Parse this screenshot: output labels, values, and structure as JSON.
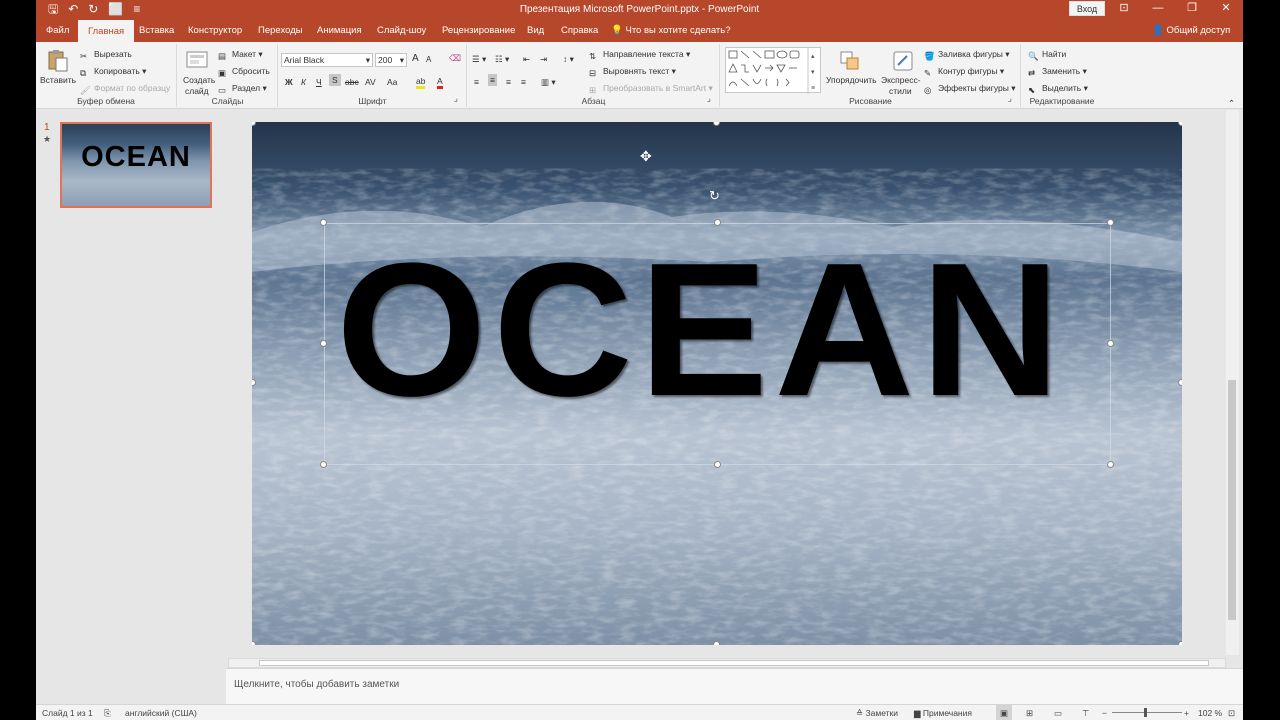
{
  "window": {
    "title": "Презентация Microsoft PowerPoint.pptx  -  PowerPoint",
    "signin_label": "Вход",
    "qat": {
      "save": "🖫",
      "undo": "↶",
      "redo": "↻",
      "present": "⬜",
      "more": "≡"
    },
    "controls": {
      "ribbon_options": "⊡",
      "minimize": "—",
      "maximize": "❐",
      "close": "✕"
    }
  },
  "tabs": [
    {
      "label": "Файл"
    },
    {
      "label": "Главная"
    },
    {
      "label": "Вставка"
    },
    {
      "label": "Конструктор"
    },
    {
      "label": "Переходы"
    },
    {
      "label": "Анимация"
    },
    {
      "label": "Слайд-шоу"
    },
    {
      "label": "Рецензирование"
    },
    {
      "label": "Вид"
    },
    {
      "label": "Справка"
    }
  ],
  "tell_me": "Что вы хотите сделать?",
  "share_label": "Общий доступ",
  "ribbon": {
    "clipboard": {
      "paste": "Вставить",
      "cut": "Вырезать",
      "copy": "Копировать",
      "format_painter": "Формат по образцу",
      "label": "Буфер обмена"
    },
    "slides": {
      "new_slide_line1": "Создать",
      "new_slide_line2": "слайд",
      "layout": "Макет",
      "reset": "Сбросить",
      "section": "Раздел",
      "label": "Слайды"
    },
    "font": {
      "font_name": "Arial Black",
      "font_size": "200",
      "grow": "A",
      "shrink": "A",
      "bold": "Ж",
      "italic": "К",
      "underline": "Ч",
      "shadow": "S",
      "strike": "abc",
      "spacing": "AV",
      "case": "Aa",
      "label": "Шрифт"
    },
    "paragraph": {
      "text_direction": "Направление текста",
      "align_text": "Выровнять текст",
      "smartart": "Преобразовать в SmartArt",
      "label": "Абзац"
    },
    "drawing": {
      "arrange": "Упорядочить",
      "quick_styles_line1": "Экспресс-",
      "quick_styles_line2": "стили",
      "shape_fill": "Заливка фигуры",
      "shape_outline": "Контур фигуры",
      "shape_effects": "Эффекты фигуры",
      "label": "Рисование"
    },
    "editing": {
      "find": "Найти",
      "replace": "Заменить",
      "select": "Выделить",
      "label": "Редактирование"
    }
  },
  "thumbnail": {
    "number": "1",
    "star": "★",
    "text": "OCEAN"
  },
  "slide": {
    "text": "OCEAN",
    "rotate_glyph": "↻"
  },
  "notes_placeholder": "Щелкните, чтобы добавить заметки",
  "status": {
    "slide_info": "Слайд 1 из 1",
    "language": "английский (США)",
    "notes": "Заметки",
    "comments": "Примечания",
    "zoom": "102 %",
    "zoom_minus": "−",
    "zoom_plus": "+"
  },
  "colors": {
    "accent": "#b7472a",
    "thumb_border": "#e07555"
  }
}
